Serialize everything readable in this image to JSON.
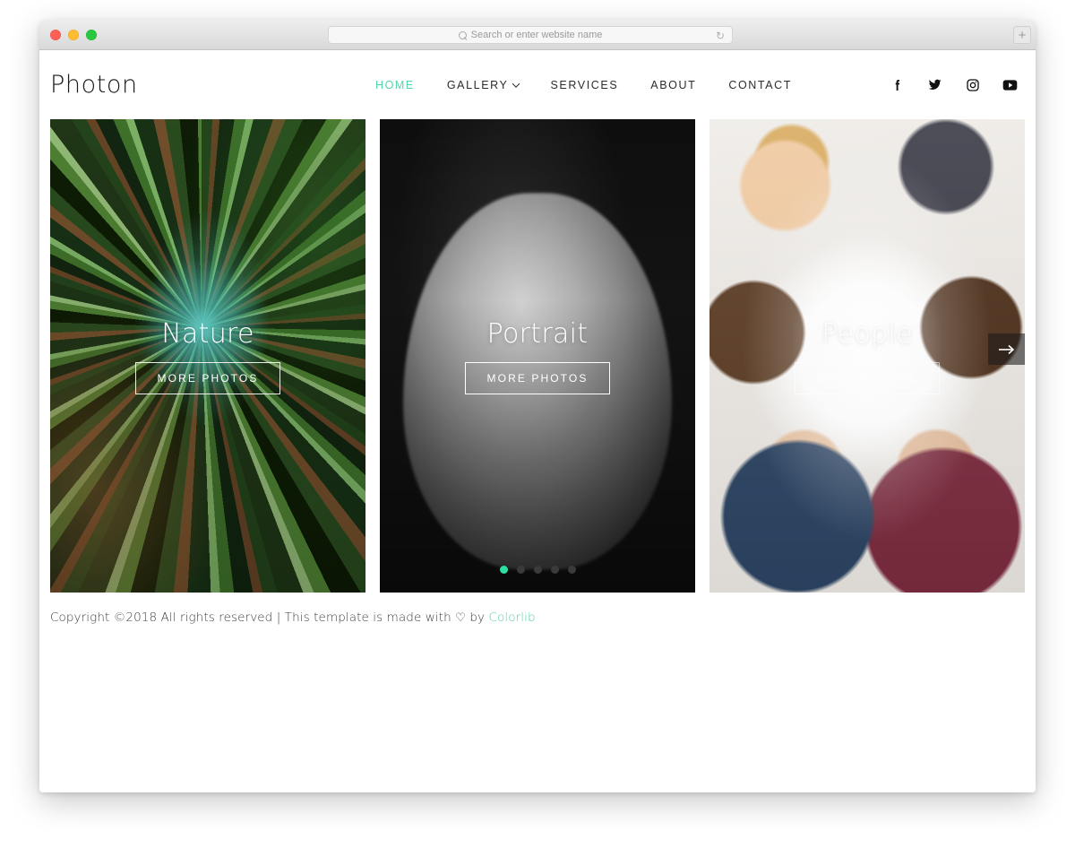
{
  "browser": {
    "traffic_lights": [
      "close",
      "minimize",
      "zoom"
    ],
    "address_placeholder": "Search or enter website name",
    "address_value": "",
    "reload_icon": "reload-icon",
    "search_icon": "search-icon",
    "new_tab_label": "+"
  },
  "site": {
    "logo": "Photon",
    "nav": [
      {
        "label": "HOME",
        "active": true,
        "has_dropdown": false
      },
      {
        "label": "GALLERY",
        "active": false,
        "has_dropdown": true
      },
      {
        "label": "SERVICES",
        "active": false,
        "has_dropdown": false
      },
      {
        "label": "ABOUT",
        "active": false,
        "has_dropdown": false
      },
      {
        "label": "CONTACT",
        "active": false,
        "has_dropdown": false
      }
    ],
    "socials": [
      {
        "name": "facebook-icon",
        "label": "Facebook"
      },
      {
        "name": "twitter-icon",
        "label": "Twitter"
      },
      {
        "name": "instagram-icon",
        "label": "Instagram"
      },
      {
        "name": "youtube-icon",
        "label": "YouTube"
      }
    ],
    "accent_color": "#52d6a8",
    "active_nav_color": "#52d6a8"
  },
  "slider": {
    "slides": [
      {
        "title": "Nature",
        "button": "MORE PHOTOS",
        "theme": "forest-canopy"
      },
      {
        "title": "Portrait",
        "button": "MORE PHOTOS",
        "theme": "black-and-white-portrait"
      },
      {
        "title": "People",
        "button": "MORE PHOTOS",
        "theme": "group-of-people"
      }
    ],
    "next_arrow": "arrow-right-icon",
    "dots": 5,
    "active_dot_index": 0,
    "active_dot_color": "#2ddfa3",
    "inactive_dot_color": "#3a3a3a"
  },
  "footer": {
    "text_before": "Copyright ©2018 All rights reserved | This template is made with ",
    "heart": "♡",
    "text_middle": " by ",
    "brand": "Colorlib",
    "brand_color": "#4fd3a5"
  }
}
